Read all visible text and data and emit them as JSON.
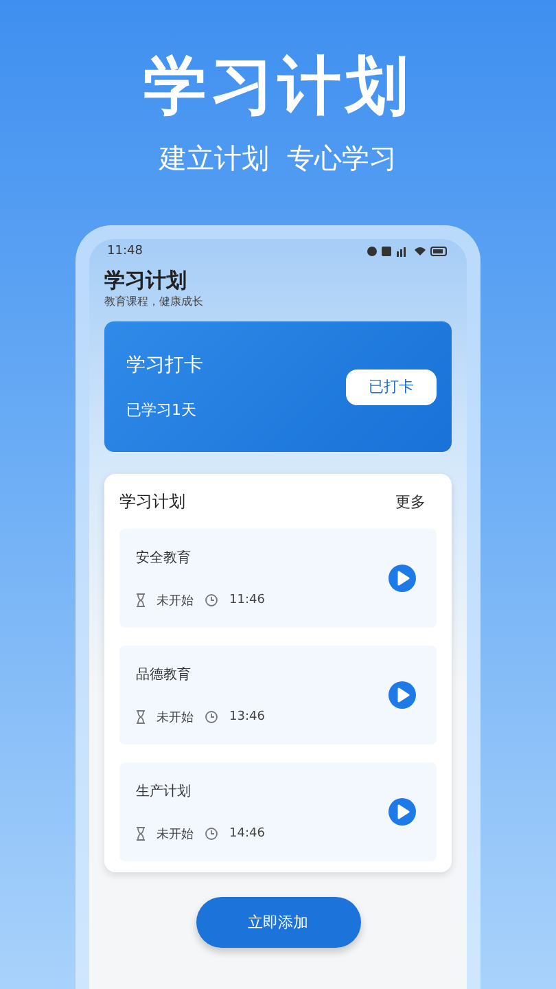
{
  "promo": {
    "headline": "学习计划",
    "tagline": "建立计划  专心学习"
  },
  "status_bar": {
    "time": "11:48"
  },
  "app": {
    "title": "学习计划",
    "subtitle": "教育课程，健康成长"
  },
  "checkin": {
    "title": "学习打卡",
    "days": "已学习1天",
    "button": "已打卡"
  },
  "plans": {
    "title": "学习计划",
    "more": "更多",
    "items": [
      {
        "name": "安全教育",
        "status": "未开始",
        "time": "11:46"
      },
      {
        "name": "品德教育",
        "status": "未开始",
        "time": "13:46"
      },
      {
        "name": "生产计划",
        "status": "未开始",
        "time": "14:46"
      }
    ]
  },
  "add_button": "立即添加"
}
